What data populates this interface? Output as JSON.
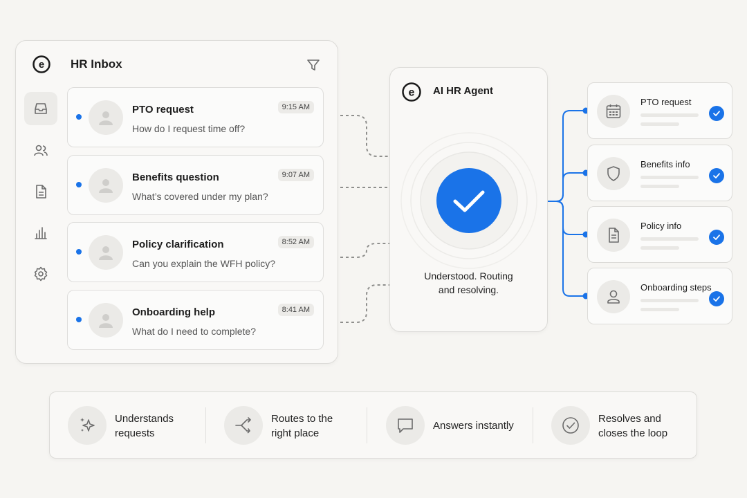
{
  "inbox": {
    "title": "HR Inbox",
    "brand_letter": "e",
    "nav": [
      "inbox-icon",
      "people-icon",
      "document-icon",
      "bar-chart-icon",
      "gear-icon"
    ],
    "messages": [
      {
        "subject": "PTO request",
        "preview": "How do I request time off?",
        "time": "9:15 AM",
        "unread": true
      },
      {
        "subject": "Benefits question",
        "preview": "What’s covered under my plan?",
        "time": "9:07 AM",
        "unread": true
      },
      {
        "subject": "Policy clarification",
        "preview": "Can you explain the WFH policy?",
        "time": "8:52 AM",
        "unread": true
      },
      {
        "subject": "Onboarding help",
        "preview": "What do I need to complete?",
        "time": "8:41 AM",
        "unread": true
      }
    ]
  },
  "agent": {
    "brand_letter": "e",
    "title": "AI HR Agent",
    "status_line1": "Understood. Routing",
    "status_line2": "and resolving."
  },
  "results": [
    {
      "label": "PTO request",
      "icon": "calendar-icon",
      "done": true
    },
    {
      "label": "Benefits info",
      "icon": "shield-icon",
      "done": true
    },
    {
      "label": "Policy info",
      "icon": "document-icon",
      "done": true
    },
    {
      "label": "Onboarding steps",
      "icon": "user-icon",
      "done": true
    }
  ],
  "features": [
    {
      "line1": "Understands",
      "line2": "requests",
      "icon": "sparkle-icon"
    },
    {
      "line1": "Routes to the",
      "line2": "right place",
      "icon": "split-arrow-icon"
    },
    {
      "line1": "Answers instantly",
      "line2": "",
      "icon": "chat-bubble-icon"
    },
    {
      "line1": "Resolves and",
      "line2": "closes the loop",
      "icon": "check-circle-icon"
    }
  ],
  "colors": {
    "accent": "#1a73e8",
    "background": "#f6f5f2",
    "card": "#fbfbfa",
    "border": "#dcdbd8"
  }
}
